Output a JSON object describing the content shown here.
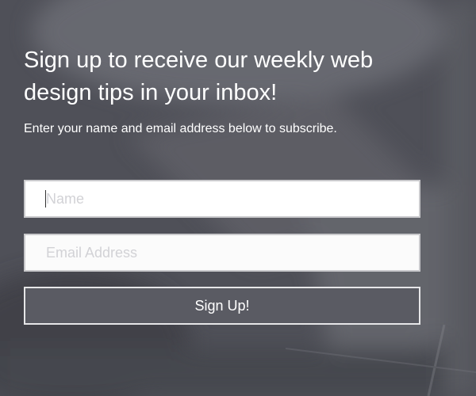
{
  "signup": {
    "headline": "Sign up to receive our weekly web design tips in your inbox!",
    "subtext": "Enter your name and email address below to subscribe.",
    "name_placeholder": "Name",
    "email_placeholder": "Email Address",
    "submit_label": "Sign Up!"
  },
  "colors": {
    "background": "#4f5058",
    "text": "#ffffff",
    "field_border": "#c9c9cc",
    "button_border": "#e6e6e8"
  }
}
